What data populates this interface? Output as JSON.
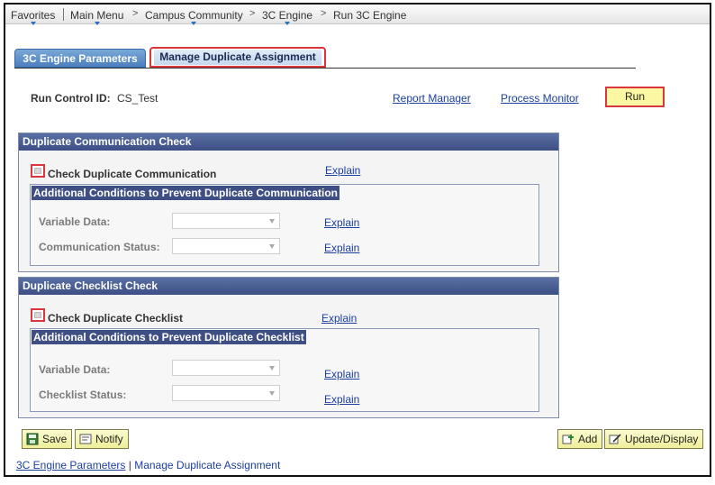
{
  "breadcrumb": {
    "items": [
      "Favorites",
      "Main Menu",
      "Campus Community",
      "3C Engine",
      "Run 3C Engine"
    ]
  },
  "tabs": [
    {
      "label": "3C Engine Parameters",
      "active": false
    },
    {
      "label": "Manage Duplicate Assignment",
      "active": true
    }
  ],
  "run_control": {
    "label": "Run Control ID:",
    "value": "CS_Test",
    "report_manager": "Report Manager",
    "process_monitor": "Process Monitor",
    "run_label": "Run"
  },
  "comm_check": {
    "title": "Duplicate Communication Check",
    "checkbox_label": "Check Duplicate Communication",
    "checked": false,
    "explain": "Explain",
    "conditions_title": "Additional Conditions to Prevent Duplicate Communication",
    "fields": [
      {
        "label": "Variable Data:",
        "value": "",
        "explain": "Explain"
      },
      {
        "label": "Communication Status:",
        "value": "",
        "explain": "Explain"
      }
    ]
  },
  "checklist_check": {
    "title": "Duplicate Checklist Check",
    "checkbox_label": "Check Duplicate Checklist",
    "checked": false,
    "explain": "Explain",
    "conditions_title": "Additional Conditions to Prevent Duplicate Checklist",
    "fields": [
      {
        "label": "Variable Data:",
        "value": "",
        "explain": "Explain"
      },
      {
        "label": "Checklist Status:",
        "value": "",
        "explain": "Explain"
      }
    ]
  },
  "toolbar": {
    "save": "Save",
    "notify": "Notify",
    "add": "Add",
    "update_display": "Update/Display"
  },
  "footer_links": {
    "params": "3C Engine Parameters",
    "separator": " | ",
    "current": "Manage Duplicate Assignment"
  },
  "colors": {
    "highlight_border": "#d9363e",
    "group_header": "#3d4f84",
    "link": "#1c3fa0",
    "run_button": "#fbf7a3"
  }
}
